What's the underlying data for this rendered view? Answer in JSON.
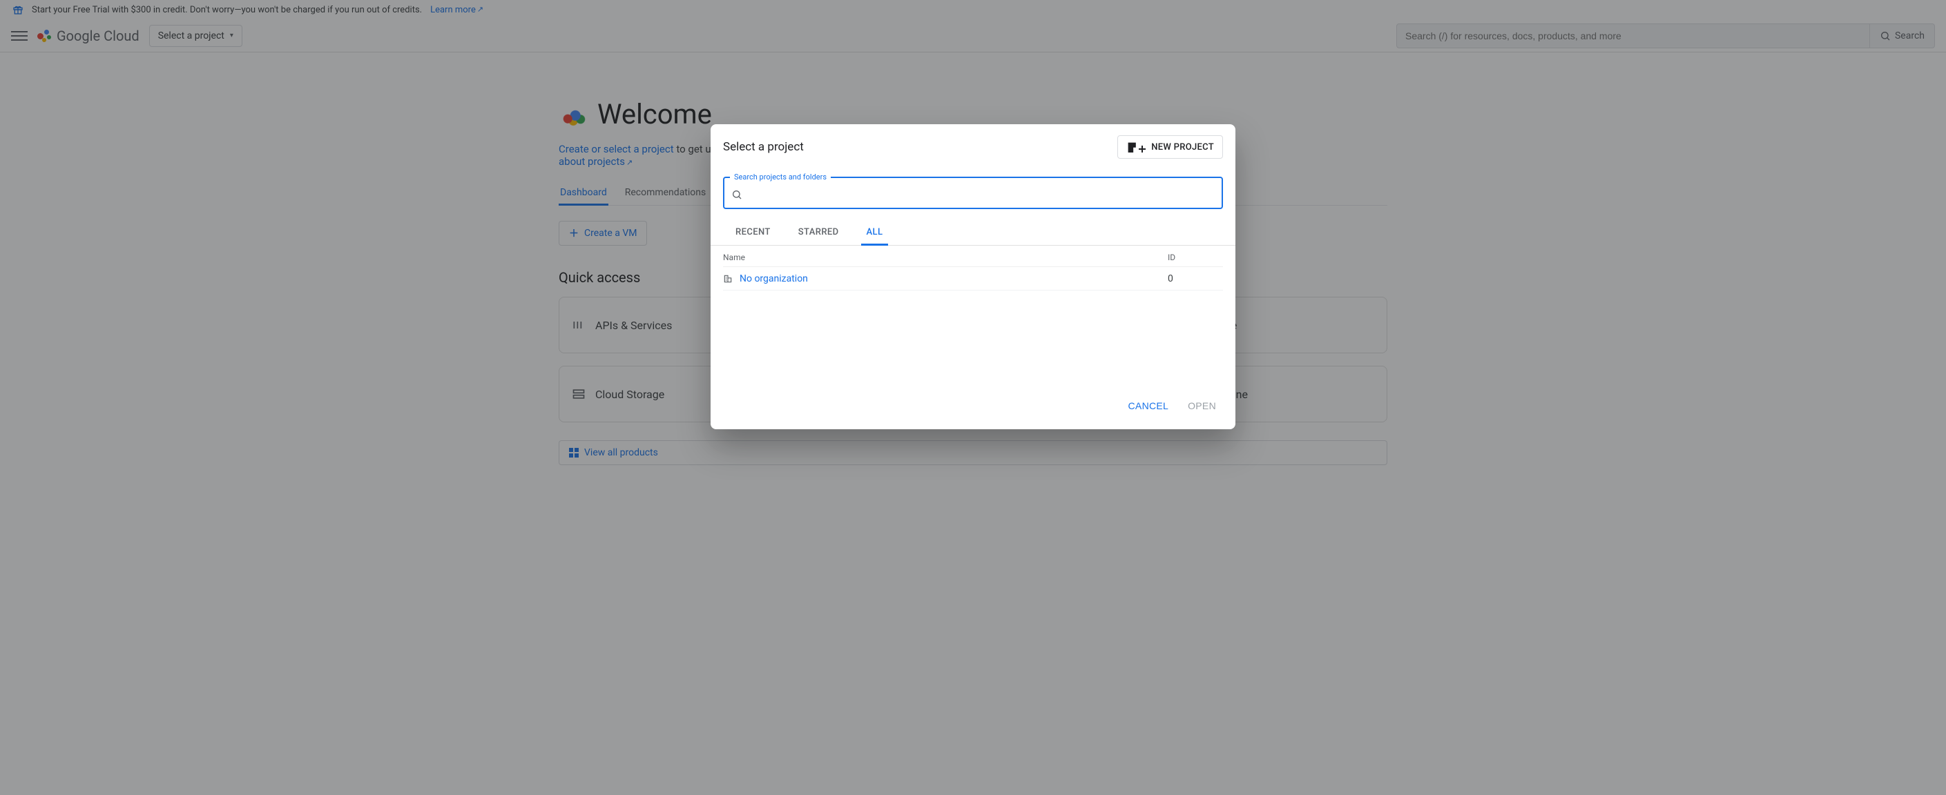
{
  "promo": {
    "text": "Start your Free Trial with $300 in credit. Don't worry—you won't be charged if you run out of credits.",
    "learn_more": "Learn more"
  },
  "header": {
    "logo_text": "Google Cloud",
    "project_chip": "Select a project",
    "search_placeholder": "Search (/) for resources, docs, products, and more",
    "search_button": "Search"
  },
  "hero": {
    "title": "Welcome",
    "link_create": "Create or select a project",
    "desc_mid": " to get up and running with Google Cloud. ",
    "link_learn": "Learn more about projects"
  },
  "welcome_tabs": {
    "dashboard": "Dashboard",
    "recommendations": "Recommendations"
  },
  "pills": {
    "vm": "Create a VM"
  },
  "quick_access": {
    "title": "Quick access",
    "cards": {
      "apis": "APIs & Services",
      "storage": "Cloud Storage",
      "compute": "Compute Engine",
      "kubernetes": "Kubernetes Engine"
    },
    "view_all": "View all products"
  },
  "dialog": {
    "title": "Select a project",
    "new_project": "NEW PROJECT",
    "search_legend": "Search projects and folders",
    "tabs": {
      "recent": "RECENT",
      "starred": "STARRED",
      "all": "ALL"
    },
    "columns": {
      "name": "Name",
      "id": "ID"
    },
    "rows": [
      {
        "name": "No organization",
        "id": "0"
      }
    ],
    "cancel": "CANCEL",
    "open": "OPEN"
  }
}
